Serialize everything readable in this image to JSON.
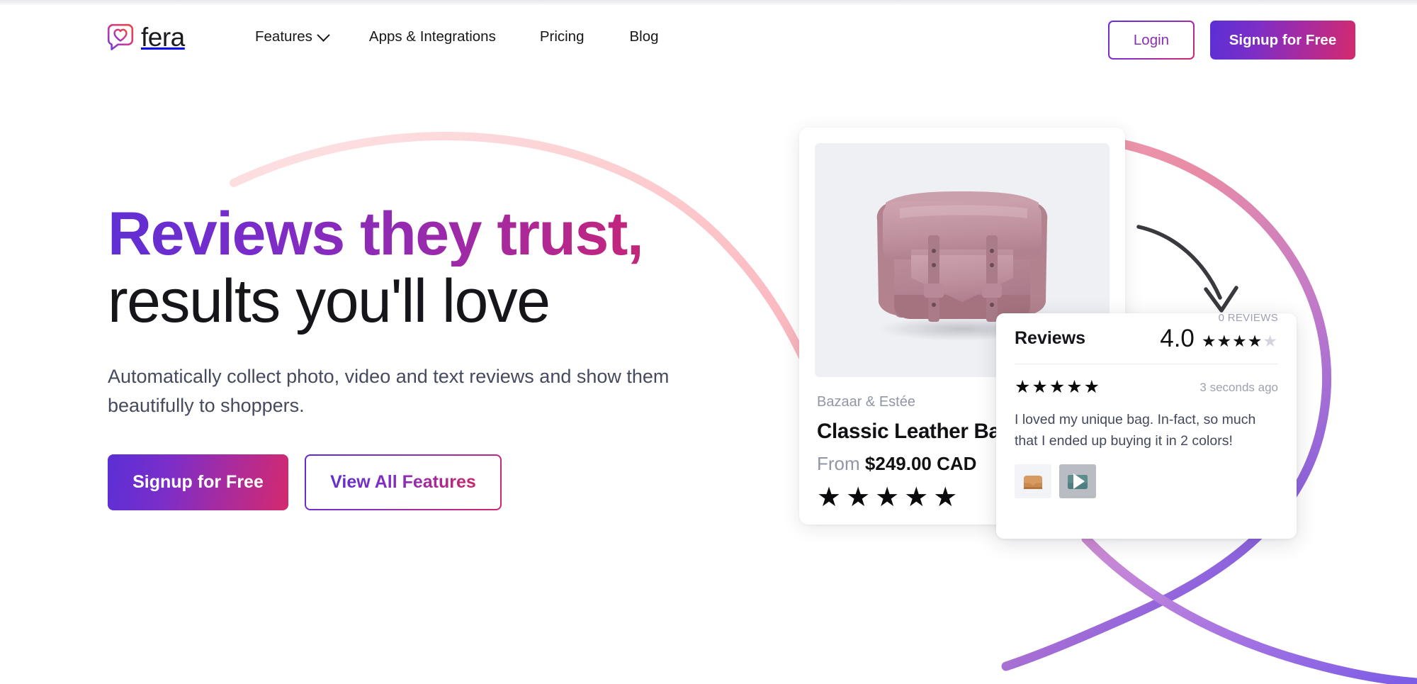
{
  "brand": {
    "logo_icon": "speech-bubble-heart-icon",
    "name": "fera"
  },
  "nav": {
    "items": [
      {
        "label": "Features",
        "has_dropdown": true,
        "icon": "chevron-down-icon"
      },
      {
        "label": "Apps & Integrations",
        "has_dropdown": false
      },
      {
        "label": "Pricing",
        "has_dropdown": false
      },
      {
        "label": "Blog",
        "has_dropdown": false
      }
    ],
    "login_label": "Login",
    "signup_label": "Signup for Free"
  },
  "hero": {
    "headline_line1": "Reviews they trust,",
    "headline_line2": "results you'll love",
    "subhead": "Automatically collect photo, video and text reviews and show them beautifully to shoppers.",
    "primary_cta": "Signup for Free",
    "secondary_cta": "View All Features"
  },
  "product_card": {
    "vendor": "Bazaar & Estée",
    "title": "Classic Leather Bag",
    "price_prefix": "From",
    "price": "$249.00 CAD",
    "stars": "★★★★★",
    "image_alt": "pink-leather-messenger-bag"
  },
  "reviews_widget": {
    "title": "Reviews",
    "average_score": "4.0",
    "stars_filled": "★★★★",
    "stars_empty": "★",
    "count_label": "0 REVIEWS",
    "review": {
      "stars": "★★★★★",
      "time": "3 seconds ago",
      "text": "I loved my unique bag. In-fact, so much that I ended up buying it in 2 colors!",
      "thumbnails": [
        {
          "type": "photo",
          "name": "tan-bag-photo-thumbnail"
        },
        {
          "type": "video",
          "name": "teal-bag-video-thumbnail"
        }
      ]
    }
  },
  "decor": {
    "arc_pink_top": "#f9bdc0",
    "arc_pink_mid": "#e88ba6",
    "arc_purple_end": "#7c5ce6",
    "arrow": "curved-down-right-arrow"
  },
  "colors": {
    "gradient_start": "#5b2fd6",
    "gradient_mid": "#9c2aa8",
    "gradient_end": "#d42a6e",
    "text_dark": "#16161a",
    "text_muted": "#454a5e",
    "image_bg": "#eef0f4"
  }
}
